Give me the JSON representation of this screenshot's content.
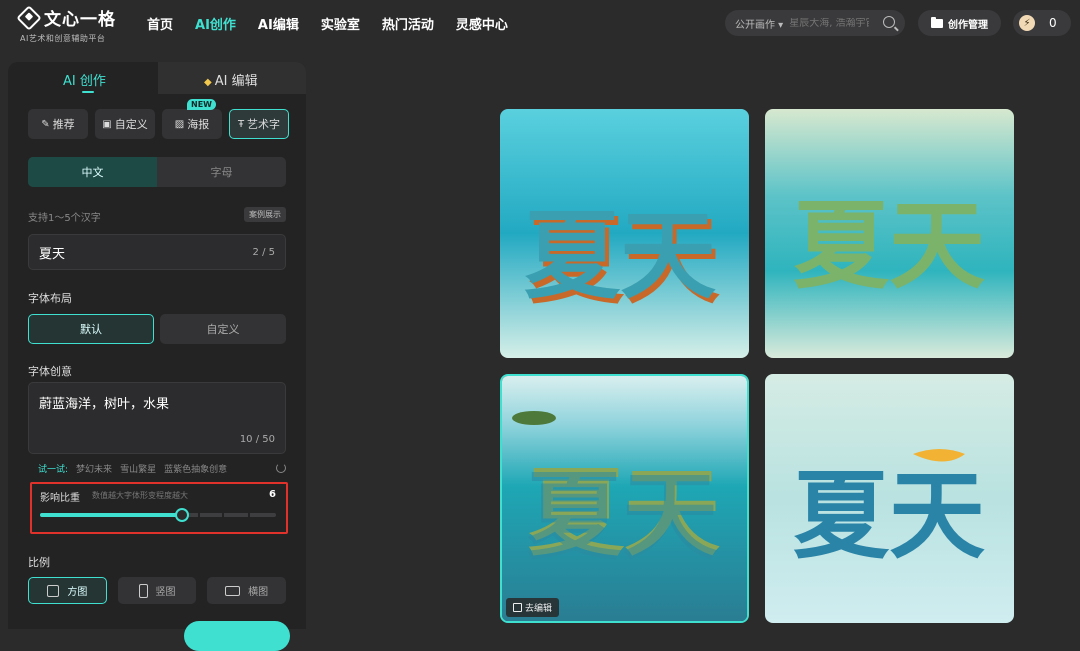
{
  "brand": {
    "title": "文心一格",
    "subtitle": "AI艺术和创意辅助平台"
  },
  "nav": [
    "首页",
    "AI创作",
    "AI编辑",
    "实验室",
    "热门活动",
    "灵感中心"
  ],
  "search": {
    "scope": "公开画作 ▾",
    "placeholder": "星辰大海, 浩瀚宇宙"
  },
  "header_buttons": {
    "manage": "创作管理",
    "points": "0"
  },
  "panel": {
    "tab_create": "AI 创作",
    "tab_edit": "AI 编辑",
    "types": [
      "推荐",
      "自定义",
      "海报",
      "艺术字"
    ],
    "new_badge": "NEW",
    "lang": [
      "中文",
      "字母"
    ],
    "hint": "支持1～5个汉字",
    "example": "案例展示",
    "text_value": "夏天",
    "text_count": "2 / 5",
    "layout_label": "字体布局",
    "layout": [
      "默认",
      "自定义"
    ],
    "idea_label": "字体创意",
    "idea_value": "蔚蓝海洋，树叶，水果",
    "idea_count": "10 / 50",
    "try_label": "试一试:",
    "try_items": [
      "梦幻未来",
      "雪山繁星",
      "蓝紫色抽象创意"
    ],
    "weight_label": "影响比重",
    "weight_desc": "数值越大字体形变程度越大",
    "weight_value": "6",
    "weight_fraction": 0.6,
    "ratio_label": "比例",
    "ratios": [
      "方图",
      "竖图",
      "横图"
    ]
  },
  "gallery": {
    "card_text": "夏天",
    "edit_label": "去编辑"
  },
  "colors": {
    "accent": "#3fe0d0",
    "highlight_border": "#e0312b"
  }
}
